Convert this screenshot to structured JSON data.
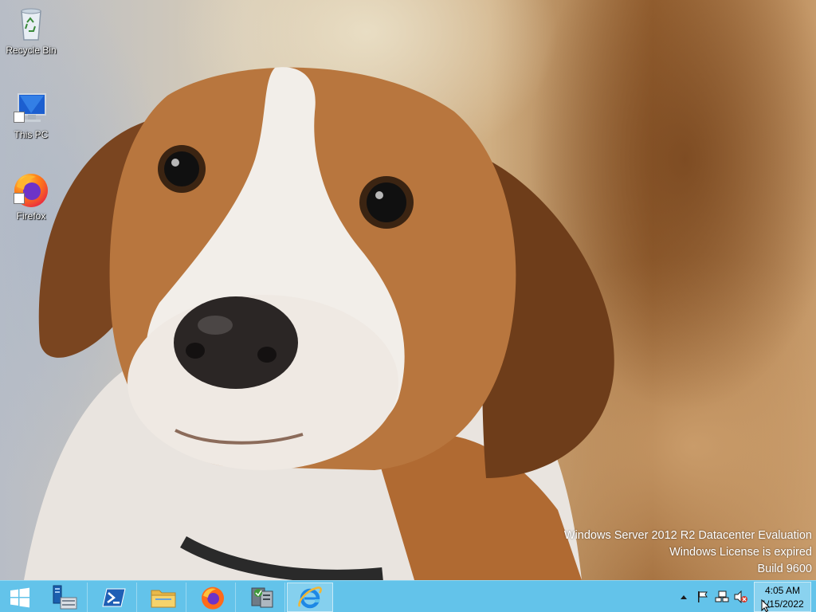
{
  "desktop": {
    "icons": [
      {
        "label": "Recycle Bin",
        "icon": "recycle-bin-icon"
      },
      {
        "label": "This PC",
        "icon": "this-pc-icon"
      },
      {
        "label": "Firefox",
        "icon": "firefox-icon"
      }
    ],
    "watermark": {
      "line1": "Windows Server 2012 R2 Datacenter Evaluation",
      "line2": "Windows License is expired",
      "line3": "Build 9600"
    }
  },
  "taskbar": {
    "color": "#63c3ea",
    "start": {
      "icon": "windows-start-icon"
    },
    "pinned": [
      {
        "icon": "server-manager-icon"
      },
      {
        "icon": "powershell-icon"
      },
      {
        "icon": "file-explorer-icon"
      },
      {
        "icon": "firefox-icon"
      },
      {
        "icon": "mmc-tools-icon"
      },
      {
        "icon": "internet-explorer-icon"
      }
    ],
    "tray": {
      "icons": [
        "show-hidden-icons-chevron",
        "action-center-flag-icon",
        "network-icon",
        "volume-muted-icon"
      ]
    },
    "clock": {
      "time": "4:05 AM",
      "date": "1/15/2022"
    }
  }
}
